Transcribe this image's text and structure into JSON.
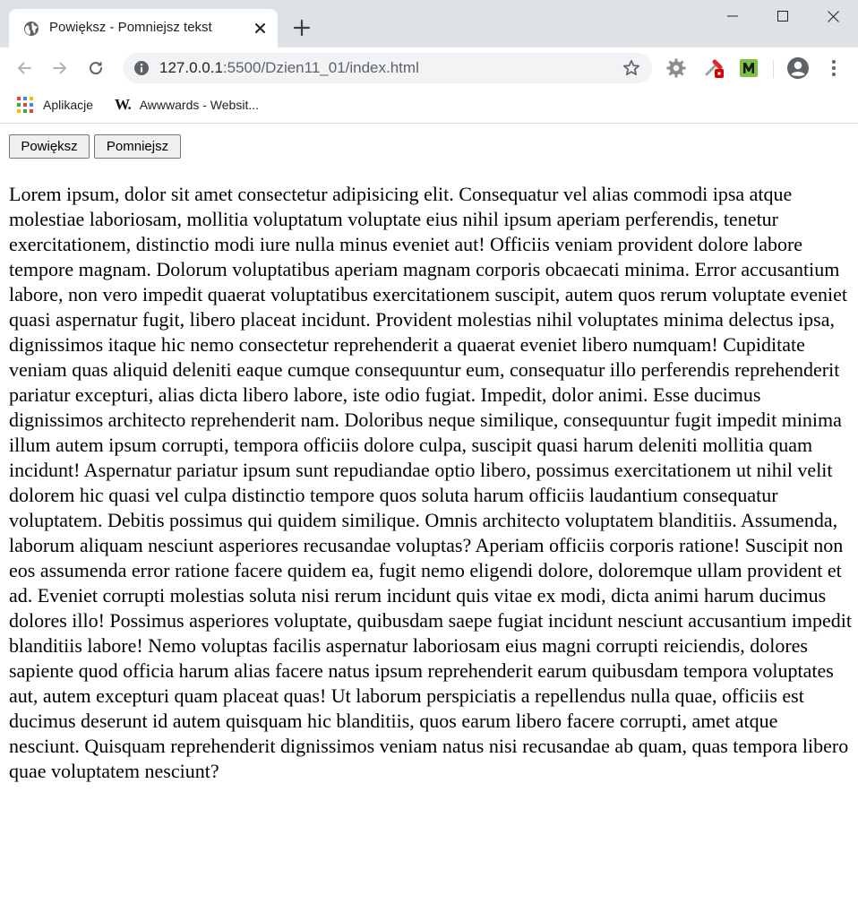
{
  "browser": {
    "tab": {
      "title": "Powiększ - Pomniejsz tekst"
    },
    "address": {
      "host": "127.0.0.1",
      "path": ":5500/Dzien11_01/index.html"
    },
    "bookmarks": [
      {
        "label": "Aplikacje",
        "icon": "apps-grid-icon"
      },
      {
        "label": "Awwwards - Websit...",
        "icon": "awwwards-icon",
        "glyph": "W."
      }
    ],
    "extensions": [
      "gear-extension-icon",
      "color-picker-extension-icon",
      "m-extension-icon"
    ]
  },
  "page": {
    "buttons": {
      "increase_label": "Powiększ",
      "decrease_label": "Pomniejsz"
    },
    "paragraph": "Lorem ipsum, dolor sit amet consectetur adipisicing elit. Consequatur vel alias commodi ipsa atque molestiae laboriosam, mollitia voluptatum voluptate eius nihil ipsum aperiam perferendis, tenetur exercitationem, distinctio modi iure nulla minus eveniet aut! Officiis veniam provident dolore labore tempore magnam. Dolorum voluptatibus aperiam magnam corporis obcaecati minima. Error accusantium labore, non vero impedit quaerat voluptatibus exercitationem suscipit, autem quos rerum voluptate eveniet quasi aspernatur fugit, libero placeat incidunt. Provident molestias nihil voluptates minima delectus ipsa, dignissimos itaque hic nemo consectetur reprehenderit a quaerat eveniet libero numquam! Cupiditate veniam quas aliquid deleniti eaque cumque consequuntur eum, consequatur illo perferendis reprehenderit pariatur excepturi, alias dicta libero labore, iste odio fugiat. Impedit, dolor animi. Esse ducimus dignissimos architecto reprehenderit nam. Doloribus neque similique, consequuntur fugit impedit minima illum autem ipsum corrupti, tempora officiis dolore culpa, suscipit quasi harum deleniti mollitia quam incidunt! Aspernatur pariatur ipsum sunt repudiandae optio libero, possimus exercitationem ut nihil velit dolorem hic quasi vel culpa distinctio tempore quos soluta harum officiis laudantium consequatur voluptatem. Debitis possimus qui quidem similique. Omnis architecto voluptatem blanditiis. Assumenda, laborum aliquam nesciunt asperiores recusandae voluptas? Aperiam officiis corporis ratione! Suscipit non eos assumenda error ratione facere quidem ea, fugit nemo eligendi dolore, doloremque ullam provident et ad. Eveniet corrupti molestias soluta nisi rerum incidunt quis vitae ex modi, dicta animi harum ducimus dolores illo! Possimus asperiores voluptate, quibusdam saepe fugiat incidunt nesciunt accusantium impedit blanditiis labore! Nemo voluptas facilis aspernatur laboriosam eius magni corrupti reiciendis, dolores sapiente quod officia harum alias facere natus ipsum reprehenderit earum quibusdam tempora voluptates aut, autem excepturi quam placeat quas! Ut laborum perspiciatis a repellendus nulla quae, officiis est ducimus deserunt id autem quisquam hic blanditiis, quos earum libero facere corrupti, amet atque nesciunt. Quisquam reprehenderit dignissimos veniam natus nisi recusandae ab quam, quas tempora libero quae voluptatem nesciunt?"
  }
}
